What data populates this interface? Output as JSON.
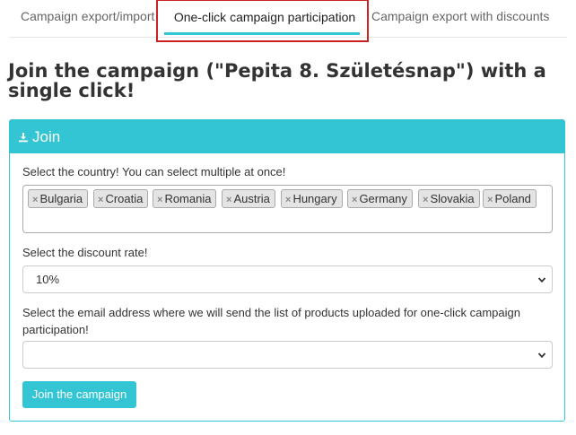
{
  "tabs": [
    {
      "label": "Campaign export/import"
    },
    {
      "label": "One-click campaign participation"
    },
    {
      "label": "Campaign export with discounts"
    }
  ],
  "active_tab": 1,
  "title": "Join the campaign (\"Pepita 8. Születésnap\") with a single click!",
  "panel": {
    "header": "Join",
    "header_icon": "download-icon",
    "country_label": "Select the country! You can select multiple at once!",
    "countries": [
      "Bulgaria",
      "Croatia",
      "Romania",
      "Austria",
      "Hungary",
      "Germany",
      "Slovakia",
      "Poland"
    ],
    "chip_remove_symbol": "×",
    "discount_label": "Select the discount rate!",
    "discount_value": "10%",
    "email_label": "Select the email address where we will send the list of products uploaded for one-click campaign participation!",
    "email_value": "",
    "submit_label": "Join the campaign"
  },
  "colors": {
    "accent": "#33c5d3",
    "highlight_border": "#cc2222"
  }
}
